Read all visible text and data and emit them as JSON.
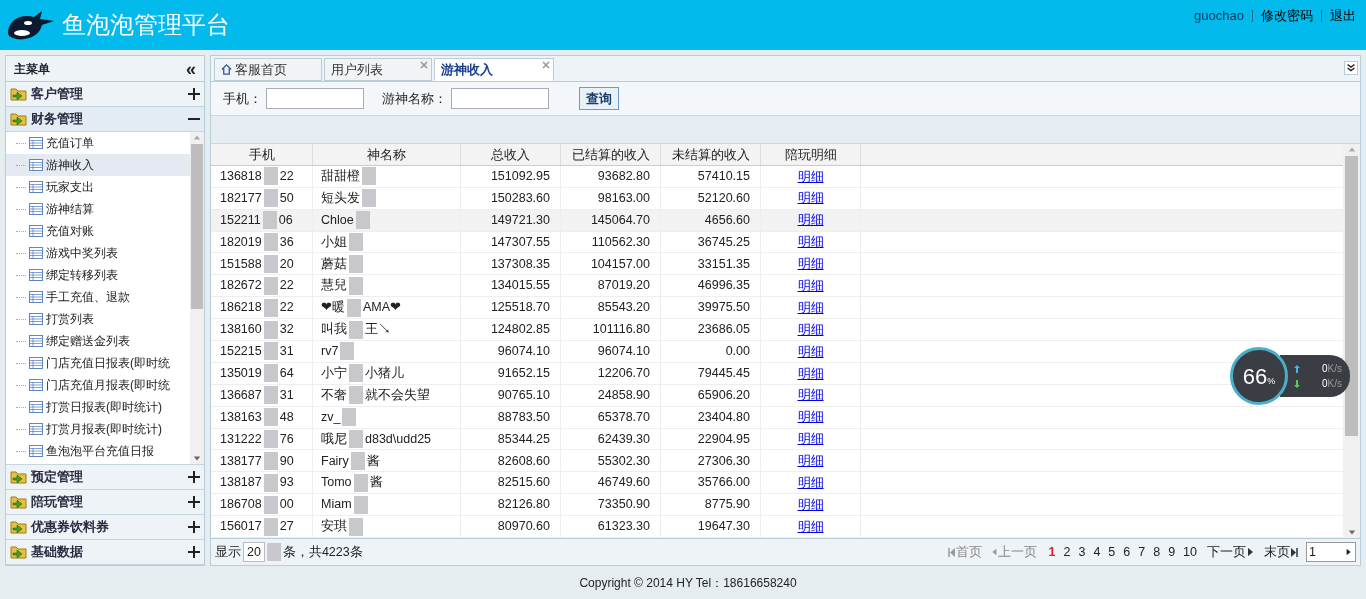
{
  "header": {
    "title": "鱼泡泡管理平台",
    "user": "guochao",
    "links": [
      "修改密码",
      "退出"
    ]
  },
  "sidebar": {
    "title": "主菜单",
    "collapse_icon": "«",
    "groups": [
      {
        "label": "客户管理",
        "expanded": false
      },
      {
        "label": "财务管理",
        "expanded": true,
        "items": [
          {
            "label": "充值订单",
            "selected": false
          },
          {
            "label": "游神收入",
            "selected": true
          },
          {
            "label": "玩家支出",
            "selected": false
          },
          {
            "label": "游神结算",
            "selected": false
          },
          {
            "label": "充值对账",
            "selected": false
          },
          {
            "label": "游戏中奖列表",
            "selected": false
          },
          {
            "label": "绑定转移列表",
            "selected": false
          },
          {
            "label": "手工充值、退款",
            "selected": false
          },
          {
            "label": "打赏列表",
            "selected": false
          },
          {
            "label": "绑定赠送金列表",
            "selected": false
          },
          {
            "label": "门店充值日报表(即时统",
            "selected": false
          },
          {
            "label": "门店充值月报表(即时统",
            "selected": false
          },
          {
            "label": "打赏日报表(即时统计)",
            "selected": false
          },
          {
            "label": "打赏月报表(即时统计)",
            "selected": false
          },
          {
            "label": "鱼泡泡平台充值日报",
            "selected": false
          }
        ]
      },
      {
        "label": "预定管理",
        "expanded": false
      },
      {
        "label": "陪玩管理",
        "expanded": false
      },
      {
        "label": "优惠券饮料券",
        "expanded": false
      },
      {
        "label": "基础数据",
        "expanded": false
      }
    ]
  },
  "tabs": [
    {
      "label": "客服首页",
      "selected": false,
      "closable": false,
      "home": true
    },
    {
      "label": "用户列表",
      "selected": false,
      "closable": true,
      "home": false
    },
    {
      "label": "游神收入",
      "selected": true,
      "closable": true,
      "home": false
    }
  ],
  "search": {
    "fields": [
      {
        "label": "手机："
      },
      {
        "label": "游神名称："
      }
    ],
    "button": "查询"
  },
  "table": {
    "columns": [
      "手机",
      "神名称",
      "总收入",
      "已结算的收入",
      "未结算的收入",
      "陪玩明细"
    ],
    "rows": [
      {
        "phone": [
          "136818",
          "22"
        ],
        "name": [
          "甜甜橙"
        ],
        "total": "151092.95",
        "settled": "93682.80",
        "unsettled": "57410.15",
        "link": "明细",
        "selected": false
      },
      {
        "phone": [
          "182177",
          "50"
        ],
        "name": [
          "短头发"
        ],
        "total": "150283.60",
        "settled": "98163.00",
        "unsettled": "52120.60",
        "link": "明细",
        "selected": false
      },
      {
        "phone": [
          "152211",
          "06"
        ],
        "name": [
          "Chloe"
        ],
        "total": "149721.30",
        "settled": "145064.70",
        "unsettled": "4656.60",
        "link": "明细",
        "selected": true
      },
      {
        "phone": [
          "182019",
          "36"
        ],
        "name": [
          "小姐"
        ],
        "total": "147307.55",
        "settled": "110562.30",
        "unsettled": "36745.25",
        "link": "明细",
        "selected": false
      },
      {
        "phone": [
          "151588",
          "20"
        ],
        "name": [
          "蘑菇"
        ],
        "total": "137308.35",
        "settled": "104157.00",
        "unsettled": "33151.35",
        "link": "明细",
        "selected": false
      },
      {
        "phone": [
          "182672",
          "22"
        ],
        "name": [
          "慧兒"
        ],
        "total": "134015.55",
        "settled": "87019.20",
        "unsettled": "46996.35",
        "link": "明细",
        "selected": false
      },
      {
        "phone": [
          "186218",
          "22"
        ],
        "name": [
          "❤暖",
          "AMA❤"
        ],
        "total": "125518.70",
        "settled": "85543.20",
        "unsettled": "39975.50",
        "link": "明细",
        "selected": false
      },
      {
        "phone": [
          "138160",
          "32"
        ],
        "name": [
          "叫我",
          "王↘"
        ],
        "total": "124802.85",
        "settled": "101116.80",
        "unsettled": "23686.05",
        "link": "明细",
        "selected": false
      },
      {
        "phone": [
          "152215",
          "31"
        ],
        "name": [
          "rv7"
        ],
        "total": "96074.10",
        "settled": "96074.10",
        "unsettled": "0.00",
        "link": "明细",
        "selected": false
      },
      {
        "phone": [
          "135019",
          "64"
        ],
        "name": [
          "小宁",
          "小猪儿"
        ],
        "total": "91652.15",
        "settled": "12206.70",
        "unsettled": "79445.45",
        "link": "明细",
        "selected": false
      },
      {
        "phone": [
          "136687",
          "31"
        ],
        "name": [
          "不奢",
          "就不会失望"
        ],
        "total": "90765.10",
        "settled": "24858.90",
        "unsettled": "65906.20",
        "link": "明细",
        "selected": false
      },
      {
        "phone": [
          "138163",
          "48"
        ],
        "name": [
          "zv_"
        ],
        "total": "88783.50",
        "settled": "65378.70",
        "unsettled": "23404.80",
        "link": "明细",
        "selected": false
      },
      {
        "phone": [
          "131222",
          "76"
        ],
        "name": [
          "哦尼",
          "d83d\\udd25"
        ],
        "total": "85344.25",
        "settled": "62439.30",
        "unsettled": "22904.95",
        "link": "明细",
        "selected": false
      },
      {
        "phone": [
          "138177",
          "90"
        ],
        "name": [
          "Fairy",
          "酱"
        ],
        "total": "82608.60",
        "settled": "55302.30",
        "unsettled": "27306.30",
        "link": "明细",
        "selected": false
      },
      {
        "phone": [
          "138187",
          "93"
        ],
        "name": [
          "Tomo",
          "酱"
        ],
        "total": "82515.60",
        "settled": "46749.60",
        "unsettled": "35766.00",
        "link": "明细",
        "selected": false
      },
      {
        "phone": [
          "186708",
          "00"
        ],
        "name": [
          "Miam"
        ],
        "total": "82126.80",
        "settled": "73350.90",
        "unsettled": "8775.90",
        "link": "明细",
        "selected": false
      },
      {
        "phone": [
          "156017",
          "27"
        ],
        "name": [
          "安琪"
        ],
        "total": "80970.60",
        "settled": "61323.30",
        "unsettled": "19647.30",
        "link": "明细",
        "selected": false
      }
    ]
  },
  "pager": {
    "show": "显示",
    "page_size": "20",
    "total": "条，共4223条",
    "first": "首页",
    "prev": "上一页",
    "pages": [
      {
        "label": "1",
        "selected": true
      },
      {
        "label": "2",
        "selected": false
      },
      {
        "label": "3",
        "selected": false
      },
      {
        "label": "4",
        "selected": false
      },
      {
        "label": "5",
        "selected": false
      },
      {
        "label": "6",
        "selected": false
      },
      {
        "label": "7",
        "selected": false
      },
      {
        "label": "8",
        "selected": false
      },
      {
        "label": "9",
        "selected": false
      },
      {
        "label": "10",
        "selected": false
      }
    ],
    "next": "下一页",
    "last": "末页",
    "goto": "1"
  },
  "footer": "Copyright © 2014 HY Tel：18616658240",
  "speed_widget": {
    "percent": "66",
    "unit": "%",
    "up": "0",
    "up_unit": "K/s",
    "down": "0",
    "down_unit": "K/s"
  }
}
